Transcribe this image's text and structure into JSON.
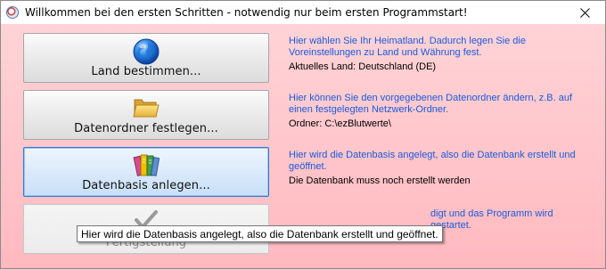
{
  "window": {
    "title": "Willkommen bei den ersten Schritten - notwendig nur beim ersten Programmstart!",
    "close_icon": "close-icon"
  },
  "steps": [
    {
      "button_label": "Land bestimmen...",
      "icon": "globe-icon",
      "description": "Hier wählen Sie Ihr Heimatland. Dadurch legen Sie die Voreinstellungen zu Land und Währung fest.",
      "status": "Aktuelles Land: Deutschland (DE)"
    },
    {
      "button_label": "Datenordner festlegen...",
      "icon": "folder-icon",
      "description": "Hier können Sie den vorgegebenen Datenordner ändern, z.B. auf einen festgelegten Netzwerk-Ordner.",
      "status": "Ordner: C:\\ezBlutwerte\\"
    },
    {
      "button_label": "Datenbasis anlegen...",
      "icon": "database-books-icon",
      "description": "Hier wird die Datenbasis angelegt, also die Datenbank erstellt und geöffnet.",
      "status": "Die Datenbank muss noch erstellt werden"
    },
    {
      "button_label": "Fertigstellung",
      "icon": "checkmark-icon",
      "description_tail": "digt und das Programm wird gestartet."
    }
  ],
  "tooltip": "Hier wird die Datenbasis angelegt, also die Datenbank erstellt und geöffnet.",
  "colors": {
    "background_top": "#ffd3d7",
    "background_bottom": "#ffb9bf",
    "description_text": "#1a5adb",
    "focus_border": "#2a7cd6"
  }
}
